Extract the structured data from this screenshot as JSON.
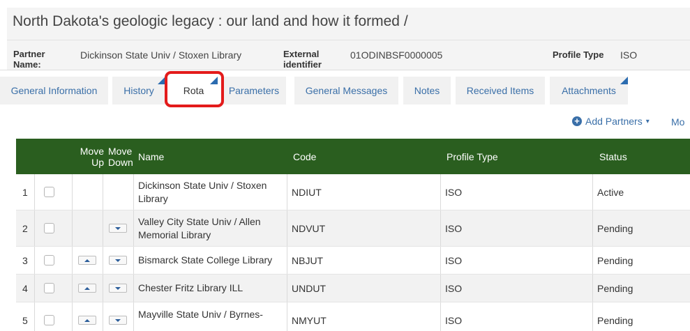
{
  "header": {
    "title": "North Dakota's geologic legacy : our land and how it formed /",
    "partner_label": "Partner Name:",
    "partner_value": "Dickinson State Univ / Stoxen Library",
    "external_label": "External identifier",
    "external_value": "01ODINBSF0000005",
    "profile_label": "Profile Type",
    "profile_value": "ISO"
  },
  "tabs": [
    {
      "label": "General Information"
    },
    {
      "label": "History"
    },
    {
      "label": "Rota"
    },
    {
      "label": "Parameters"
    },
    {
      "label": "General Messages"
    },
    {
      "label": "Notes"
    },
    {
      "label": "Received Items"
    },
    {
      "label": "Attachments"
    }
  ],
  "actions": {
    "add_partners": "Add Partners",
    "more": "Mo"
  },
  "table": {
    "columns": {
      "move_up_1": "Move",
      "move_up_2": "Up",
      "move_down_1": "Move",
      "move_down_2": "Down",
      "name": "Name",
      "code": "Code",
      "profile_type": "Profile Type",
      "status": "Status"
    },
    "rows": [
      {
        "num": "1",
        "name": "Dickinson State Univ / Stoxen Library",
        "code": "NDIUT",
        "profile": "ISO",
        "status": "Active"
      },
      {
        "num": "2",
        "name": "Valley City State Univ / Allen Memorial Library",
        "code": "NDVUT",
        "profile": "ISO",
        "status": "Pending"
      },
      {
        "num": "3",
        "name": "Bismarck State College Library",
        "code": "NBJUT",
        "profile": "ISO",
        "status": "Pending"
      },
      {
        "num": "4",
        "name": "Chester Fritz Library ILL",
        "code": "UNDUT",
        "profile": "ISO",
        "status": "Pending"
      },
      {
        "num": "5",
        "name": "Mayville State Univ / Byrnes-",
        "code": "NMYUT",
        "profile": "ISO",
        "status": "Pending"
      }
    ]
  }
}
